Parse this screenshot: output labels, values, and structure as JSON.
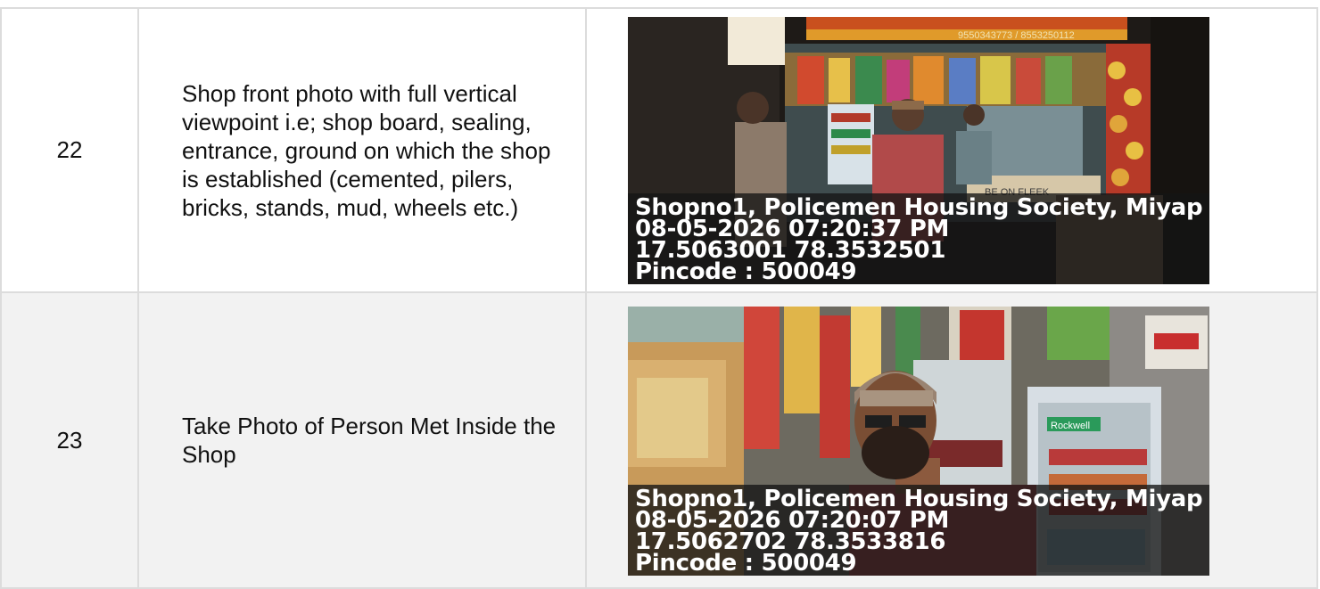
{
  "rows": [
    {
      "number": "22",
      "description": "Shop front photo with full vertical viewpoint i.e; shop board, sealing, entrance, ground on which the shop is established (cemented, pilers, bricks, stands, mud, wheels etc.)",
      "photo": {
        "address": "Shopno1, Policemen Housing Society, Miyap",
        "datetime": "08-05-2026 07:20:37 PM",
        "coords": "17.5063001 78.3532501",
        "pincode": "Pincode : 500049",
        "sign_text": "BE ON FLEEK",
        "phone_text": "9550343773 / 8553250112"
      }
    },
    {
      "number": "23",
      "description": "Take Photo of Person Met Inside the Shop",
      "photo": {
        "address": "Shopno1, Policemen Housing Society, Miyap",
        "datetime": "08-05-2026 07:20:07 PM",
        "coords": "17.5062702 78.3533816",
        "pincode": "Pincode : 500049",
        "fridge_brand": "Rockwell"
      }
    }
  ]
}
